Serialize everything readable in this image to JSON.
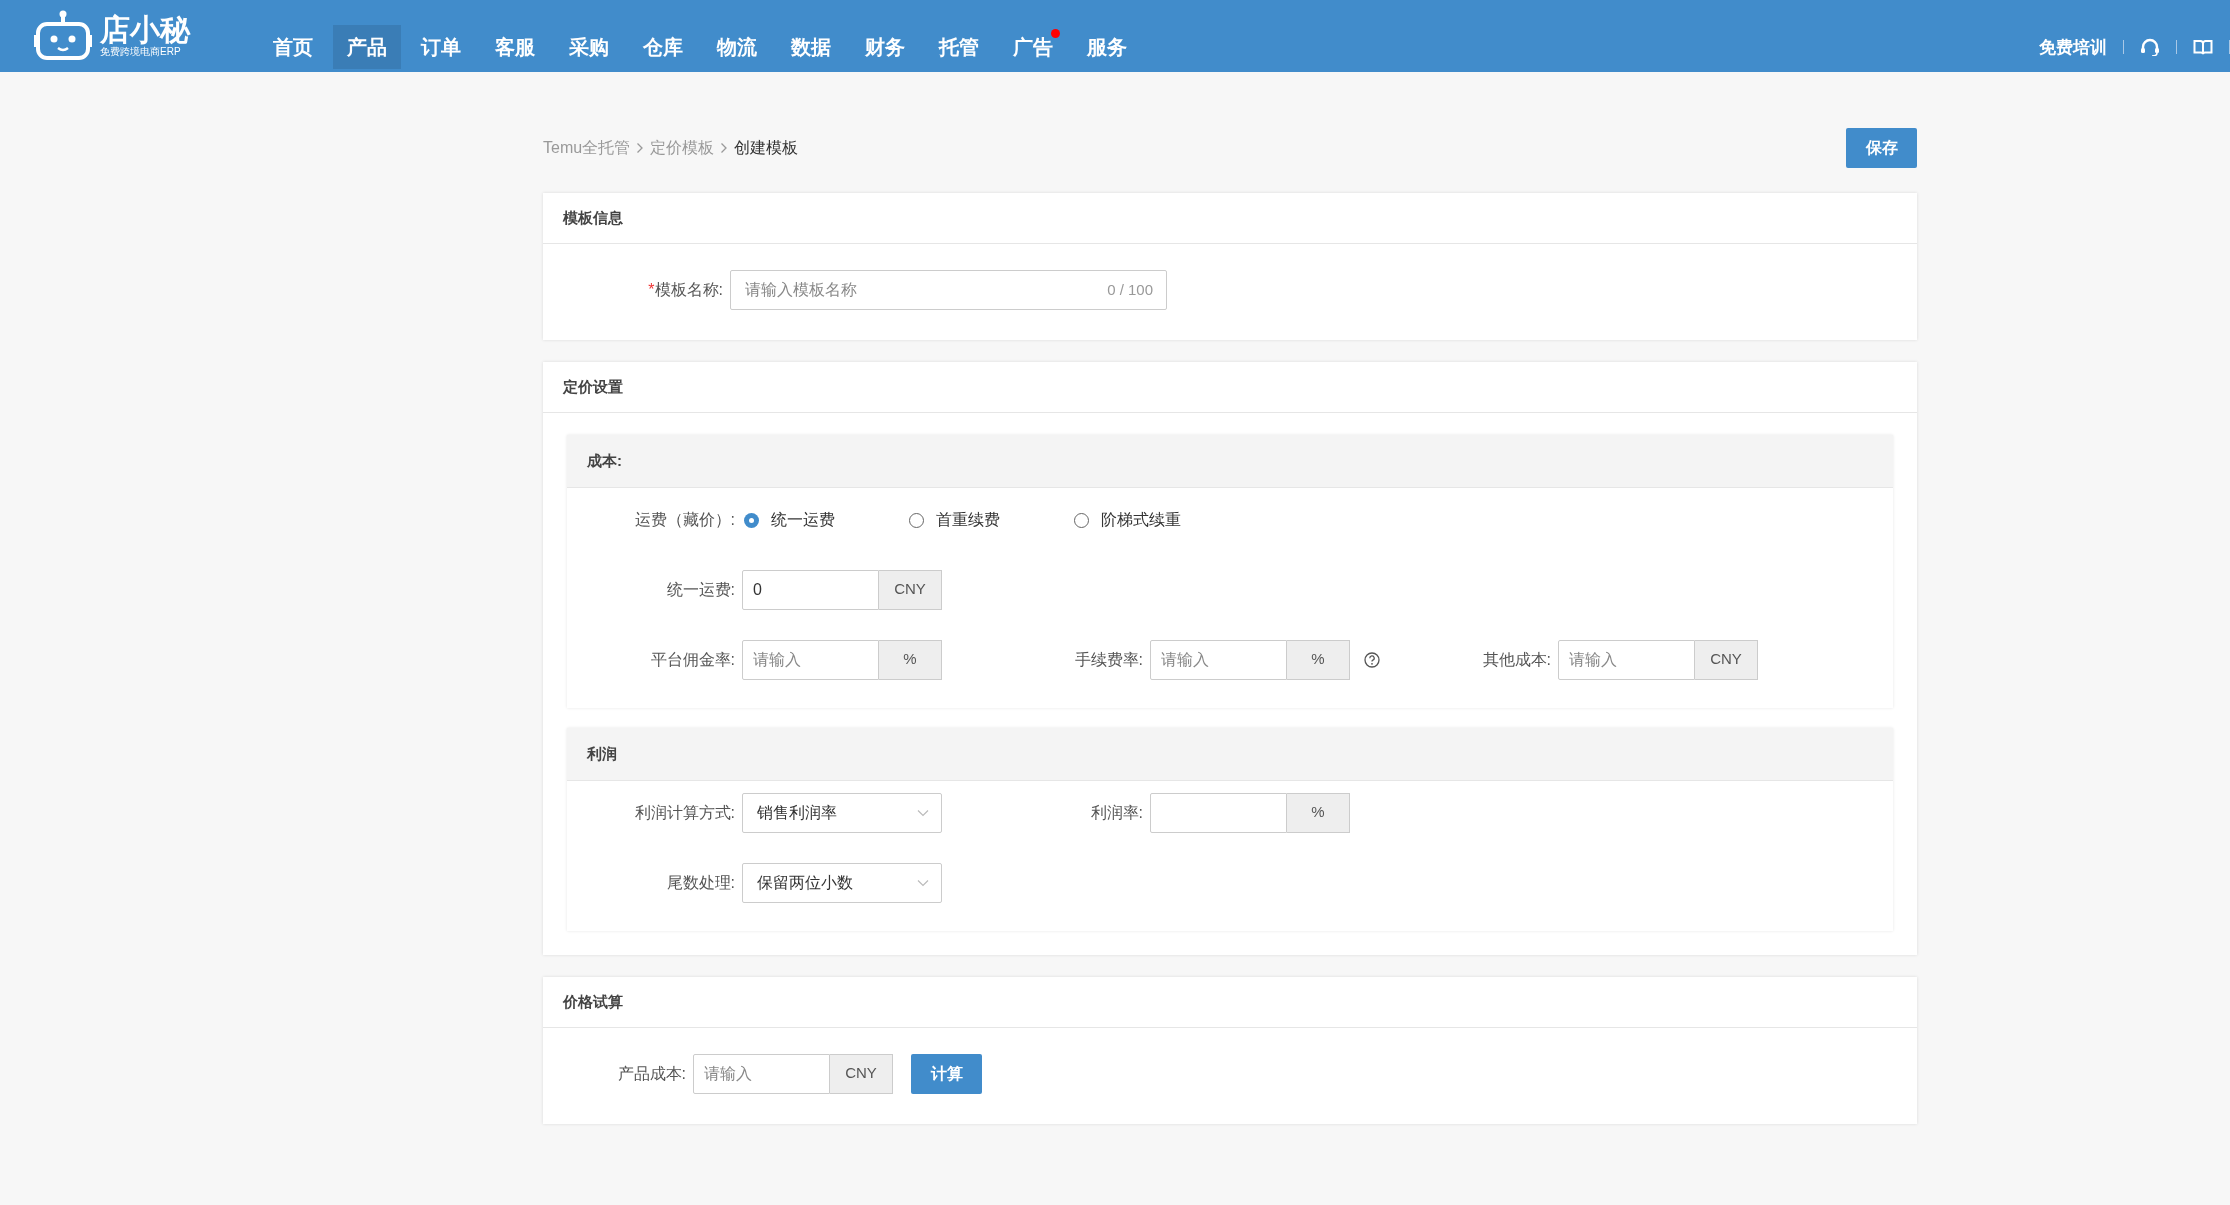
{
  "header": {
    "logo": {
      "name": "店小秘",
      "tagline": "免费跨境电商ERP"
    },
    "nav": [
      {
        "label": "首页",
        "selected": false,
        "badge": false
      },
      {
        "label": "产品",
        "selected": true,
        "badge": false
      },
      {
        "label": "订单",
        "selected": false,
        "badge": false
      },
      {
        "label": "客服",
        "selected": false,
        "badge": false
      },
      {
        "label": "采购",
        "selected": false,
        "badge": false
      },
      {
        "label": "仓库",
        "selected": false,
        "badge": false
      },
      {
        "label": "物流",
        "selected": false,
        "badge": false
      },
      {
        "label": "数据",
        "selected": false,
        "badge": false
      },
      {
        "label": "财务",
        "selected": false,
        "badge": false
      },
      {
        "label": "托管",
        "selected": false,
        "badge": false
      },
      {
        "label": "广告",
        "selected": false,
        "badge": true
      },
      {
        "label": "服务",
        "selected": false,
        "badge": false
      }
    ],
    "training": "免费培训"
  },
  "breadcrumb": [
    "Temu全托管",
    "定价模板",
    "创建模板"
  ],
  "save_button": "保存",
  "template_info": {
    "title": "模板信息",
    "field": {
      "required_mark": "*",
      "label": "模板名称:",
      "placeholder": "请输入模板名称",
      "counter": "0 / 100"
    }
  },
  "pricing": {
    "title": "定价设置",
    "cost": {
      "title": "成本:",
      "shipping": {
        "label": "运费（藏价）:",
        "options": [
          {
            "label": "统一运费",
            "selected": true
          },
          {
            "label": "首重续费",
            "selected": false
          },
          {
            "label": "阶梯式续重",
            "selected": false
          }
        ]
      },
      "rows": [
        [
          {
            "kind": "input",
            "label": "统一运费:",
            "value": "0",
            "unit": "CNY"
          }
        ],
        [
          {
            "kind": "input",
            "label": "平台佣金率:",
            "placeholder": "请输入",
            "unit": "%"
          },
          {
            "kind": "input",
            "label": "手续费率:",
            "placeholder": "请输入",
            "unit": "%",
            "help": true
          },
          {
            "kind": "input",
            "label": "其他成本:",
            "placeholder": "请输入",
            "unit": "CNY"
          }
        ]
      ]
    },
    "profit": {
      "title": "利润",
      "rows": [
        [
          {
            "kind": "select",
            "label": "利润计算方式:",
            "value": "销售利润率"
          },
          {
            "kind": "input",
            "label": "利润率:",
            "unit": "%"
          }
        ],
        [
          {
            "kind": "select",
            "label": "尾数处理:",
            "value": "保留两位小数"
          }
        ]
      ]
    }
  },
  "trial": {
    "title": "价格试算",
    "field": {
      "kind": "input",
      "label": "产品成本:",
      "placeholder": "请输入",
      "unit": "CNY"
    },
    "button": "计算"
  }
}
